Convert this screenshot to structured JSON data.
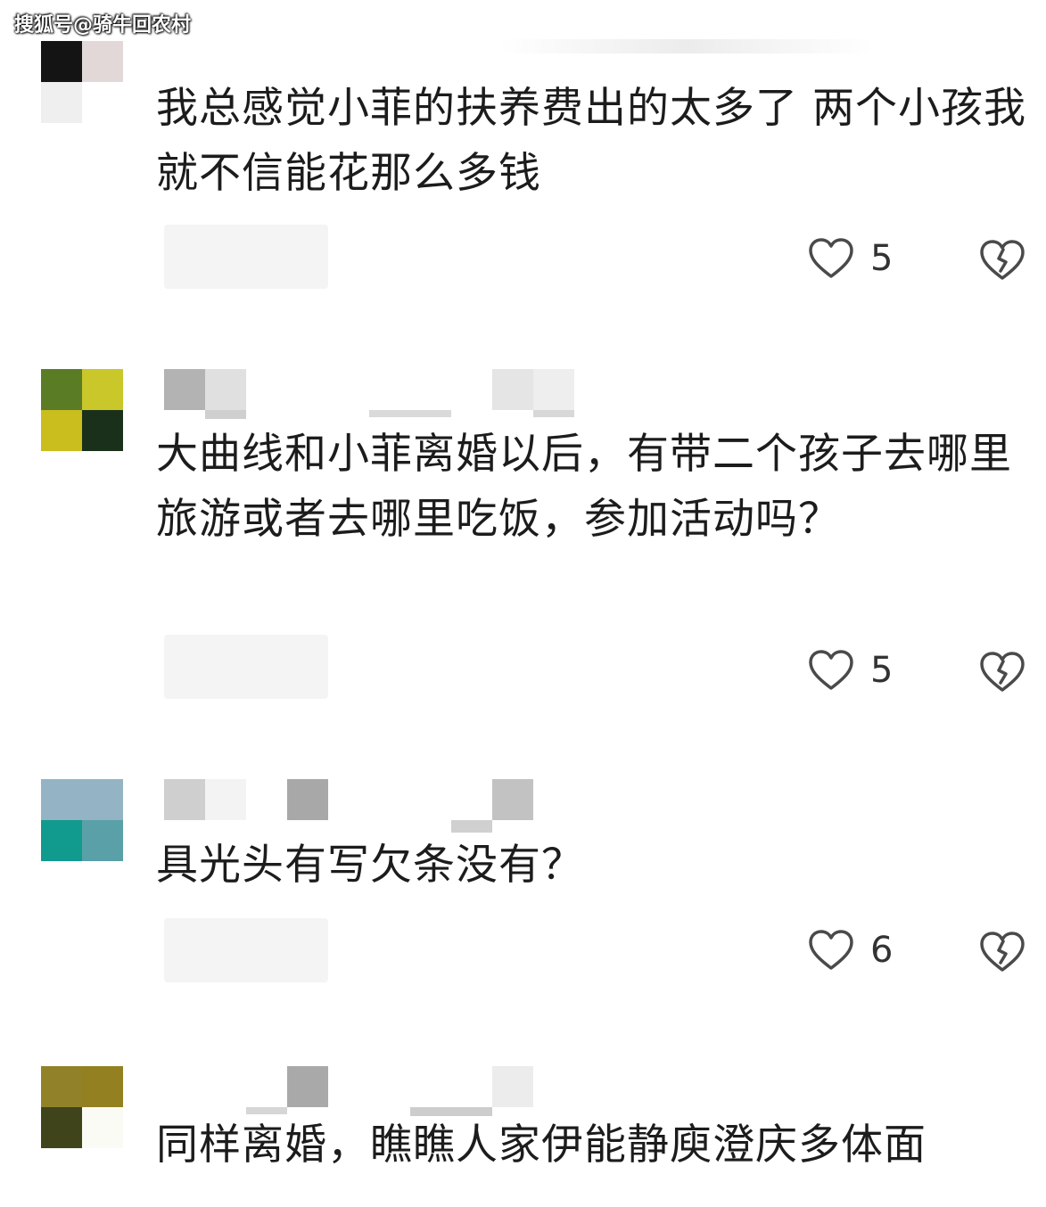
{
  "watermark": "搜狐号@骑牛回农村",
  "comments": [
    {
      "text": "我总感觉小菲的扶养费出的太多了 两个小孩我就不信能花那么多钱",
      "likes": "5",
      "avatar_colors": [
        "#141414",
        "#e2d8d8",
        "#efefef",
        "#ffffff"
      ]
    },
    {
      "text": "大曲线和小菲离婚以后，有带二个孩子去哪里旅游或者去哪里吃饭，参加活动吗？",
      "likes": "5",
      "avatar_colors": [
        "#5a7c25",
        "#c9c72a",
        "#cabd1e",
        "#1a301a"
      ]
    },
    {
      "text": "具光头有写欠条没有？",
      "likes": "6",
      "avatar_colors": [
        "#94b3c4",
        "#94b3c4",
        "#119a8e",
        "#5aa0a8"
      ]
    },
    {
      "text": "同样离婚，瞧瞧人家伊能静庾澄庆多体面",
      "likes": "",
      "avatar_colors": [
        "#918229",
        "#938021",
        "#3f441b",
        "#fbfbf5"
      ]
    }
  ],
  "icons": {
    "like": "heart-icon",
    "dislike": "broken-heart-icon"
  }
}
